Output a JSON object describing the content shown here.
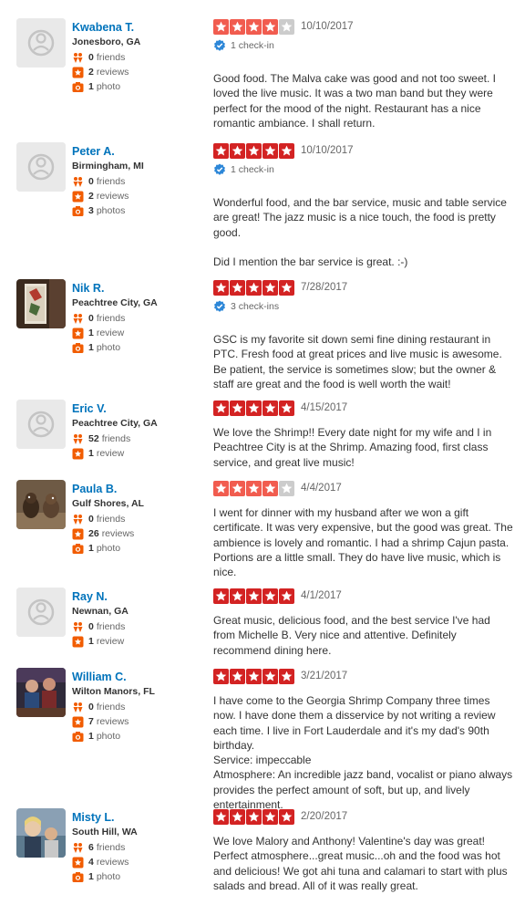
{
  "colors": {
    "star_red": "#d32323",
    "star_4": "#f15c4f",
    "star_empty": "#cccccc",
    "link_blue": "#0073bb",
    "stat_orange": "#f15c00",
    "checkin_blue": "#2d87d8"
  },
  "icons": {
    "friends": "friends-icon",
    "reviews": "review-star-icon",
    "photos": "camera-icon",
    "checkin": "checkin-badge-icon",
    "default_avatar": "default-user-avatar-icon"
  },
  "reviews": [
    {
      "name": "Kwabena T.",
      "location": "Jonesboro, GA",
      "friends_count": "0",
      "friends_label": "friends",
      "reviews_count": "2",
      "reviews_label": "reviews",
      "photos_count": "1",
      "photos_label": "photo",
      "rating": 4,
      "date": "10/10/2017",
      "checkin": "1 check-in",
      "text": "Good food. The Malva cake was good and not too sweet. I loved the live music. It was a two man band but they were perfect for the mood of the night. Restaurant has a nice romantic ambiance. I shall return.",
      "avatar": "default"
    },
    {
      "name": "Peter A.",
      "location": "Birmingham, MI",
      "friends_count": "0",
      "friends_label": "friends",
      "reviews_count": "2",
      "reviews_label": "reviews",
      "photos_count": "3",
      "photos_label": "photos",
      "rating": 5,
      "date": "10/10/2017",
      "checkin": "1 check-in",
      "text": "Wonderful food, and the bar service, music and table service are great! The jazz music is a nice touch, the food is pretty good.\n\nDid I mention  the bar service is great. :-)",
      "avatar": "default"
    },
    {
      "name": "Nik R.",
      "location": "Peachtree City, GA",
      "friends_count": "0",
      "friends_label": "friends",
      "reviews_count": "1",
      "reviews_label": "review",
      "photos_count": "1",
      "photos_label": "photo",
      "rating": 5,
      "date": "7/28/2017",
      "checkin": "3 check-ins",
      "text": "GSC is my favorite sit down semi fine dining restaurant in PTC. Fresh food at great prices and live music is awesome.  Be patient, the service is sometimes slow; but the owner & staff are great and the food is well worth the wait!",
      "avatar": "photo-art"
    },
    {
      "name": "Eric V.",
      "location": "Peachtree City, GA",
      "friends_count": "52",
      "friends_label": "friends",
      "reviews_count": "1",
      "reviews_label": "review",
      "photos_count": "",
      "photos_label": "",
      "rating": 5,
      "date": "4/15/2017",
      "checkin": "",
      "text": "We love the Shrimp!!  Every date night for my wife and I in Peachtree City is at the Shrimp. Amazing food, first class service, and great live music!",
      "avatar": "default"
    },
    {
      "name": "Paula B.",
      "location": "Gulf Shores, AL",
      "friends_count": "0",
      "friends_label": "friends",
      "reviews_count": "26",
      "reviews_label": "reviews",
      "photos_count": "1",
      "photos_label": "photo",
      "rating": 4,
      "date": "4/4/2017",
      "checkin": "",
      "text": "I went for dinner with my husband after we won a gift certificate. It was very expensive, but the good was great. The ambience is lovely and romantic. I had a shrimp Cajun pasta. Portions are a little small. They do have live music, which is nice.",
      "avatar": "photo-dogs"
    },
    {
      "name": "Ray N.",
      "location": "Newnan, GA",
      "friends_count": "0",
      "friends_label": "friends",
      "reviews_count": "1",
      "reviews_label": "review",
      "photos_count": "",
      "photos_label": "",
      "rating": 5,
      "date": "4/1/2017",
      "checkin": "",
      "text": "Great music, delicious food, and the best service I've had from Michelle B. Very nice and attentive. Definitely recommend dining here.",
      "avatar": "default"
    },
    {
      "name": "William C.",
      "location": "Wilton Manors, FL",
      "friends_count": "0",
      "friends_label": "friends",
      "reviews_count": "7",
      "reviews_label": "reviews",
      "photos_count": "1",
      "photos_label": "photo",
      "rating": 5,
      "date": "3/21/2017",
      "checkin": "",
      "text": "I have come to the Georgia Shrimp Company three times now. I have done them a disservice by not writing a review each time. I live in Fort Lauderdale and it's my dad's 90th birthday.\nService:  impeccable\nAtmosphere:  An incredible jazz band, vocalist or piano always provides the perfect amount of soft, but up, and lively entertainment.",
      "avatar": "photo-people"
    },
    {
      "name": "Misty L.",
      "location": "South Hill, WA",
      "friends_count": "6",
      "friends_label": "friends",
      "reviews_count": "4",
      "reviews_label": "reviews",
      "photos_count": "1",
      "photos_label": "photo",
      "rating": 5,
      "date": "2/20/2017",
      "checkin": "",
      "text": "We love Malory and Anthony!    Valentine's day was great! Perfect atmosphere...great music...oh and the food was hot and delicious!    We got ahi tuna and calamari to start with plus salads and bread.  All of it was really great.",
      "avatar": "photo-selfie"
    }
  ]
}
